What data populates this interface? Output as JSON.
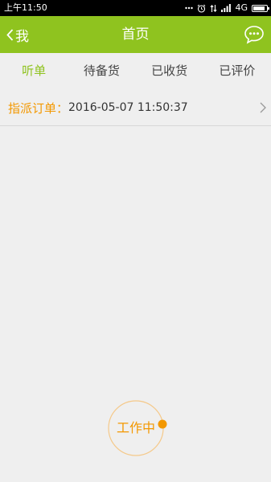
{
  "status_bar": {
    "time": "上午11:50",
    "network": "4G",
    "battery_level": 0.85
  },
  "header": {
    "back_label": "我",
    "title": "首页",
    "message_icon": "chat-bubble-icon"
  },
  "tabs": [
    {
      "label": "听单",
      "active": true
    },
    {
      "label": "待备货",
      "active": false
    },
    {
      "label": "已收货",
      "active": false
    },
    {
      "label": "已评价",
      "active": false
    }
  ],
  "order": {
    "label": "指派订单：",
    "time": "2016-05-07 11:50:37"
  },
  "work_button": {
    "label": "工作中"
  },
  "colors": {
    "brand_green": "#8fc31f",
    "accent_orange": "#f39800",
    "background": "#efefef"
  }
}
